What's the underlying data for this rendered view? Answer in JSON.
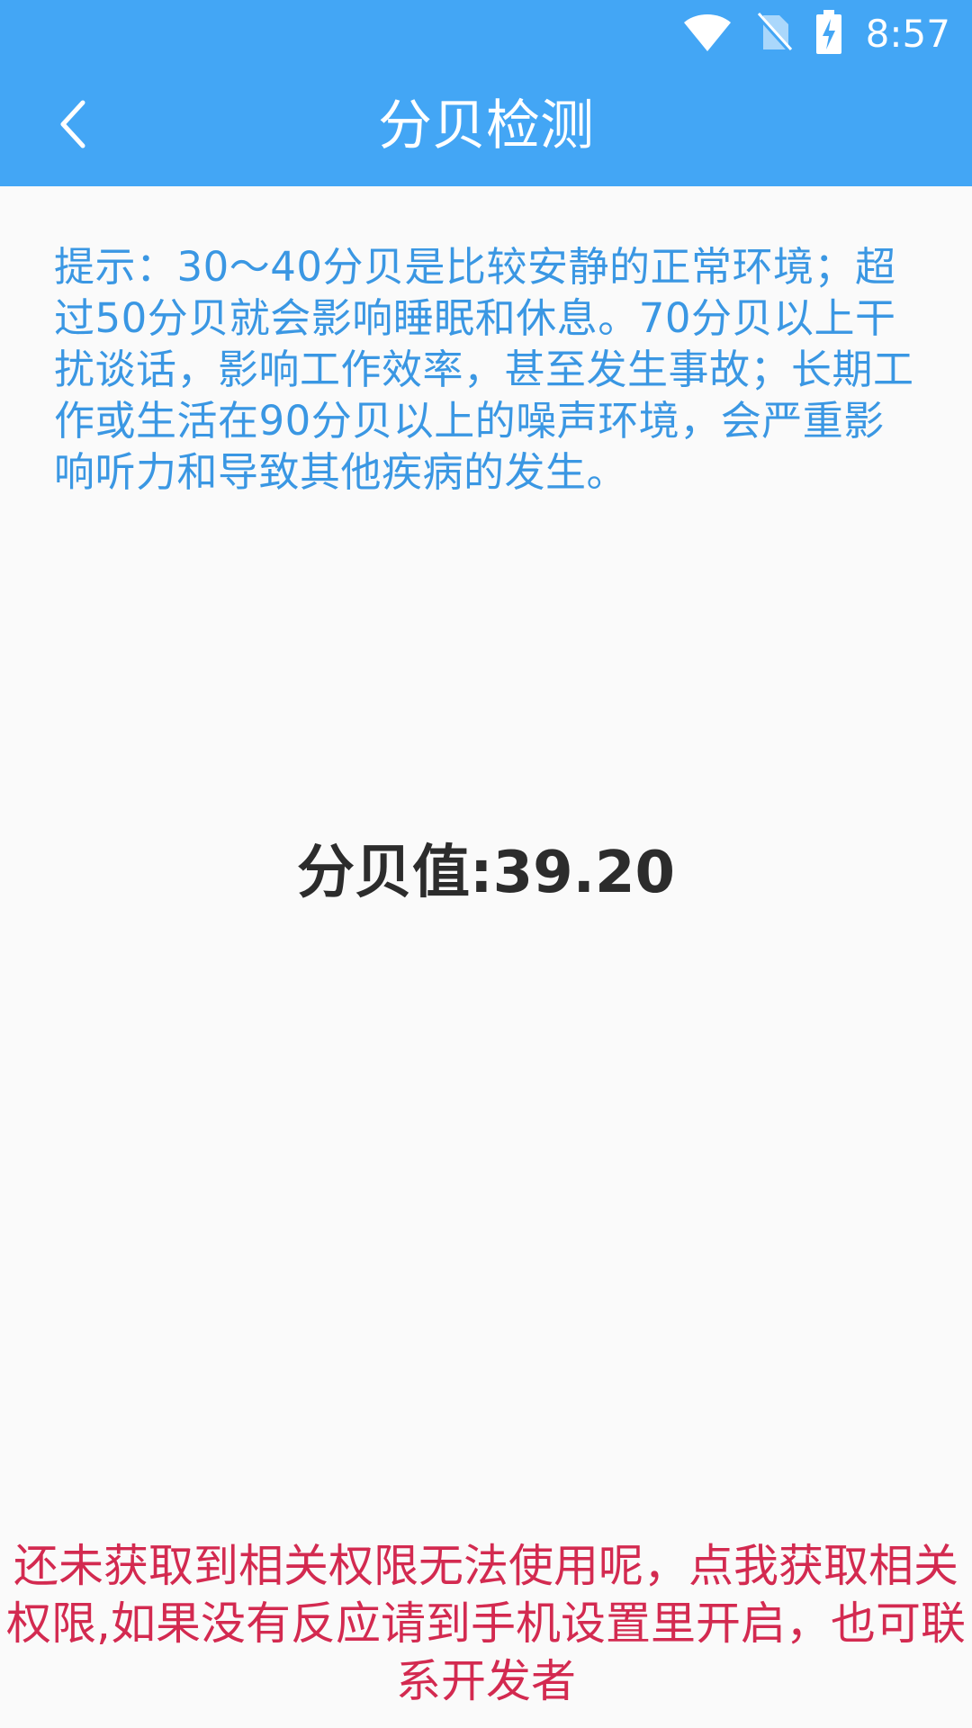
{
  "status_bar": {
    "time": "8:57",
    "icons": [
      "wifi-icon",
      "no-sim-icon",
      "battery-charging-icon"
    ]
  },
  "app_bar": {
    "title": "分贝检测",
    "back_icon": "chevron-left-icon"
  },
  "tip": {
    "text": "提示：30～40分贝是比较安静的正常环境；超过50分贝就会影响睡眠和休息。70分贝以上干扰谈话，影响工作效率，甚至发生事故；长期工作或生活在90分贝以上的噪声环境，会严重影响听力和导致其他疾病的发生。"
  },
  "meter": {
    "value_text": "分贝值:39.20"
  },
  "permission": {
    "text": "还未获取到相关权限无法使用呢，点我获取相关权限,如果没有反应请到手机设置里开启，也可联系开发者"
  },
  "colors": {
    "primary": "#43a6f5",
    "tip": "#3a97e3",
    "warning": "#d32a50",
    "background": "#fafafa"
  }
}
